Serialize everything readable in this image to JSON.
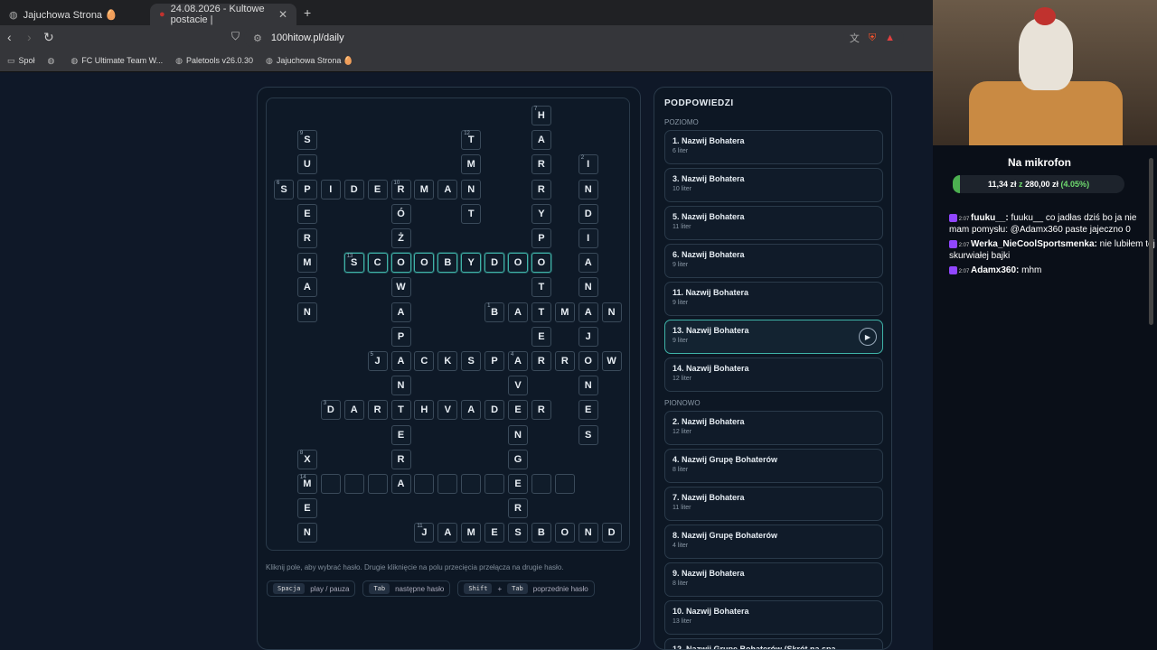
{
  "browser": {
    "tabs": [
      {
        "label": "Jajuchowa Strona 🥚"
      },
      {
        "label": "24.08.2026 - Kultowe postacie |",
        "close": "✕"
      }
    ],
    "new_tab": "+",
    "url": "100hitow.pl/daily",
    "bookmarks": [
      "Społ",
      "FC Ultimate Team W...",
      "Paletools v26.0.30",
      "Jajuchowa Strona 🥚"
    ]
  },
  "crossword": {
    "cells": [
      {
        "r": 0,
        "c": 11,
        "ch": "H",
        "n": "7"
      },
      {
        "r": 1,
        "c": 1,
        "ch": "S",
        "n": "9"
      },
      {
        "r": 1,
        "c": 8,
        "ch": "T",
        "n": "12"
      },
      {
        "r": 1,
        "c": 11,
        "ch": "A"
      },
      {
        "r": 2,
        "c": 1,
        "ch": "U"
      },
      {
        "r": 2,
        "c": 8,
        "ch": "M"
      },
      {
        "r": 2,
        "c": 11,
        "ch": "R"
      },
      {
        "r": 2,
        "c": 13,
        "ch": "I",
        "n": "2"
      },
      {
        "r": 3,
        "c": 0,
        "ch": "S",
        "n": "6"
      },
      {
        "r": 3,
        "c": 1,
        "ch": "P"
      },
      {
        "r": 3,
        "c": 2,
        "ch": "I"
      },
      {
        "r": 3,
        "c": 3,
        "ch": "D"
      },
      {
        "r": 3,
        "c": 4,
        "ch": "E"
      },
      {
        "r": 3,
        "c": 5,
        "ch": "R",
        "n": "10"
      },
      {
        "r": 3,
        "c": 6,
        "ch": "M"
      },
      {
        "r": 3,
        "c": 7,
        "ch": "A"
      },
      {
        "r": 3,
        "c": 8,
        "ch": "N"
      },
      {
        "r": 3,
        "c": 11,
        "ch": "R"
      },
      {
        "r": 3,
        "c": 13,
        "ch": "N"
      },
      {
        "r": 4,
        "c": 1,
        "ch": "E"
      },
      {
        "r": 4,
        "c": 5,
        "ch": "Ó"
      },
      {
        "r": 4,
        "c": 8,
        "ch": "T"
      },
      {
        "r": 4,
        "c": 11,
        "ch": "Y"
      },
      {
        "r": 4,
        "c": 13,
        "ch": "D"
      },
      {
        "r": 5,
        "c": 1,
        "ch": "R"
      },
      {
        "r": 5,
        "c": 5,
        "ch": "Ż"
      },
      {
        "r": 5,
        "c": 11,
        "ch": "P"
      },
      {
        "r": 5,
        "c": 13,
        "ch": "I"
      },
      {
        "r": 6,
        "c": 1,
        "ch": "M"
      },
      {
        "r": 6,
        "c": 3,
        "ch": "S",
        "n": "13",
        "hl": true
      },
      {
        "r": 6,
        "c": 4,
        "ch": "C",
        "hl": true
      },
      {
        "r": 6,
        "c": 5,
        "ch": "O",
        "hl": true
      },
      {
        "r": 6,
        "c": 6,
        "ch": "O",
        "hl": true
      },
      {
        "r": 6,
        "c": 7,
        "ch": "B",
        "hl": true
      },
      {
        "r": 6,
        "c": 8,
        "ch": "Y",
        "hl": true
      },
      {
        "r": 6,
        "c": 9,
        "ch": "D",
        "hl": true
      },
      {
        "r": 6,
        "c": 10,
        "ch": "O",
        "hl": true
      },
      {
        "r": 6,
        "c": 11,
        "ch": "O",
        "hl": true
      },
      {
        "r": 6,
        "c": 13,
        "ch": "A"
      },
      {
        "r": 7,
        "c": 1,
        "ch": "A"
      },
      {
        "r": 7,
        "c": 5,
        "ch": "W"
      },
      {
        "r": 7,
        "c": 11,
        "ch": "T"
      },
      {
        "r": 7,
        "c": 13,
        "ch": "N"
      },
      {
        "r": 8,
        "c": 1,
        "ch": "N"
      },
      {
        "r": 8,
        "c": 5,
        "ch": "A"
      },
      {
        "r": 8,
        "c": 9,
        "ch": "B",
        "n": "1"
      },
      {
        "r": 8,
        "c": 10,
        "ch": "A"
      },
      {
        "r": 8,
        "c": 11,
        "ch": "T"
      },
      {
        "r": 8,
        "c": 12,
        "ch": "M"
      },
      {
        "r": 8,
        "c": 13,
        "ch": "A"
      },
      {
        "r": 8,
        "c": 14,
        "ch": "N"
      },
      {
        "r": 9,
        "c": 5,
        "ch": "P"
      },
      {
        "r": 9,
        "c": 11,
        "ch": "E"
      },
      {
        "r": 9,
        "c": 13,
        "ch": "J"
      },
      {
        "r": 10,
        "c": 4,
        "ch": "J",
        "n": "5"
      },
      {
        "r": 10,
        "c": 5,
        "ch": "A"
      },
      {
        "r": 10,
        "c": 6,
        "ch": "C"
      },
      {
        "r": 10,
        "c": 7,
        "ch": "K"
      },
      {
        "r": 10,
        "c": 8,
        "ch": "S"
      },
      {
        "r": 10,
        "c": 9,
        "ch": "P"
      },
      {
        "r": 10,
        "c": 10,
        "ch": "A",
        "n": "4"
      },
      {
        "r": 10,
        "c": 11,
        "ch": "R"
      },
      {
        "r": 10,
        "c": 12,
        "ch": "R"
      },
      {
        "r": 10,
        "c": 13,
        "ch": "O"
      },
      {
        "r": 10,
        "c": 14,
        "ch": "W"
      },
      {
        "r": 11,
        "c": 5,
        "ch": "N"
      },
      {
        "r": 11,
        "c": 10,
        "ch": "V"
      },
      {
        "r": 11,
        "c": 13,
        "ch": "N"
      },
      {
        "r": 12,
        "c": 2,
        "ch": "D",
        "n": "3"
      },
      {
        "r": 12,
        "c": 3,
        "ch": "A"
      },
      {
        "r": 12,
        "c": 4,
        "ch": "R"
      },
      {
        "r": 12,
        "c": 5,
        "ch": "T"
      },
      {
        "r": 12,
        "c": 6,
        "ch": "H"
      },
      {
        "r": 12,
        "c": 7,
        "ch": "V"
      },
      {
        "r": 12,
        "c": 8,
        "ch": "A"
      },
      {
        "r": 12,
        "c": 9,
        "ch": "D"
      },
      {
        "r": 12,
        "c": 10,
        "ch": "E"
      },
      {
        "r": 12,
        "c": 11,
        "ch": "R"
      },
      {
        "r": 12,
        "c": 13,
        "ch": "E"
      },
      {
        "r": 13,
        "c": 5,
        "ch": "E"
      },
      {
        "r": 13,
        "c": 10,
        "ch": "N"
      },
      {
        "r": 13,
        "c": 13,
        "ch": "S"
      },
      {
        "r": 14,
        "c": 1,
        "ch": "X",
        "n": "8"
      },
      {
        "r": 14,
        "c": 5,
        "ch": "R"
      },
      {
        "r": 14,
        "c": 10,
        "ch": "G"
      },
      {
        "r": 15,
        "c": 1,
        "ch": "M",
        "n": "14"
      },
      {
        "r": 15,
        "c": 2,
        "ch": ""
      },
      {
        "r": 15,
        "c": 3,
        "ch": ""
      },
      {
        "r": 15,
        "c": 4,
        "ch": ""
      },
      {
        "r": 15,
        "c": 5,
        "ch": "A"
      },
      {
        "r": 15,
        "c": 6,
        "ch": ""
      },
      {
        "r": 15,
        "c": 7,
        "ch": ""
      },
      {
        "r": 15,
        "c": 8,
        "ch": ""
      },
      {
        "r": 15,
        "c": 9,
        "ch": ""
      },
      {
        "r": 15,
        "c": 10,
        "ch": "E"
      },
      {
        "r": 15,
        "c": 11,
        "ch": ""
      },
      {
        "r": 15,
        "c": 12,
        "ch": ""
      },
      {
        "r": 16,
        "c": 1,
        "ch": "E"
      },
      {
        "r": 16,
        "c": 10,
        "ch": "R"
      },
      {
        "r": 17,
        "c": 1,
        "ch": "N"
      },
      {
        "r": 17,
        "c": 6,
        "ch": "J",
        "n": "11"
      },
      {
        "r": 17,
        "c": 7,
        "ch": "A"
      },
      {
        "r": 17,
        "c": 8,
        "ch": "M"
      },
      {
        "r": 17,
        "c": 9,
        "ch": "E"
      },
      {
        "r": 17,
        "c": 10,
        "ch": "S"
      },
      {
        "r": 17,
        "c": 11,
        "ch": "B"
      },
      {
        "r": 17,
        "c": 12,
        "ch": "O"
      },
      {
        "r": 17,
        "c": 13,
        "ch": "N"
      },
      {
        "r": 17,
        "c": 14,
        "ch": "D"
      }
    ],
    "help": "Kliknij pole, aby wybrać hasło. Drugie kliknięcie na polu przecięcia przełącza na drugie hasło.",
    "keys": [
      {
        "k": [
          "Spacja"
        ],
        "label": "play / pauza"
      },
      {
        "k": [
          "Tab"
        ],
        "label": "następne hasło"
      },
      {
        "k": [
          "Shift",
          "Tab"
        ],
        "label": "poprzednie hasło",
        "plus": "+"
      }
    ]
  },
  "hints": {
    "title": "PODPOWIEDZI",
    "across_label": "POZIOMO",
    "down_label": "PIONOWO",
    "across": [
      {
        "t": "1. Nazwij Bohatera",
        "s": "6 liter"
      },
      {
        "t": "3. Nazwij Bohatera",
        "s": "10 liter"
      },
      {
        "t": "5. Nazwij Bohatera",
        "s": "11 liter"
      },
      {
        "t": "6. Nazwij Bohatera",
        "s": "9 liter"
      },
      {
        "t": "11. Nazwij Bohatera",
        "s": "9 liter"
      },
      {
        "t": "13. Nazwij Bohatera",
        "s": "9 liter",
        "active": true
      },
      {
        "t": "14. Nazwij Bohatera",
        "s": "12 liter"
      }
    ],
    "down": [
      {
        "t": "2. Nazwij Bohatera",
        "s": "12 liter"
      },
      {
        "t": "4. Nazwij Grupę Bohaterów",
        "s": "8 liter"
      },
      {
        "t": "7. Nazwij Bohatera",
        "s": "11 liter"
      },
      {
        "t": "8. Nazwij Grupę Bohaterów",
        "s": "4 liter"
      },
      {
        "t": "9. Nazwij Bohatera",
        "s": "8 liter"
      },
      {
        "t": "10. Nazwij Bohatera",
        "s": "13 liter"
      },
      {
        "t": "12. Nazwij Grupę Bohaterów (Skrót na spa...",
        "s": ""
      }
    ]
  },
  "stream": {
    "mic_title": "Na mikrofon",
    "amount": "11,34 zł",
    "of": "z",
    "goal": "280,00 zł",
    "pct": "(4.05%)",
    "progress": 0.0405,
    "chat": [
      {
        "time": "2:07",
        "user": "fuuku__:",
        "text": "fuuku__ co jadłas dziś bo ja nie mam pomysłu: @Adamx360 paste jajeczno 0"
      },
      {
        "time": "2:07",
        "user": "Werka_NieCoolSportsmenka:",
        "text": "nie lubiłem tej skurwiałej bajki"
      },
      {
        "time": "2:07",
        "user": "Adamx360:",
        "text": "mhm"
      }
    ]
  }
}
